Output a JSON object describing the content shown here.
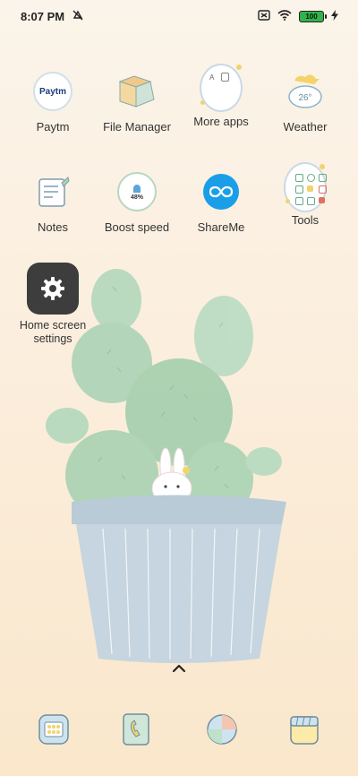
{
  "status_bar": {
    "time": "8:07 PM",
    "battery_level": "100"
  },
  "apps_row1": [
    {
      "label": "Paytm",
      "icon": "paytm-icon",
      "icon_text": "Paytm"
    },
    {
      "label": "File Manager",
      "icon": "file-manager-icon"
    },
    {
      "label": "More apps",
      "icon": "folder-more-apps-icon"
    },
    {
      "label": "Weather",
      "icon": "weather-icon",
      "icon_text": "26°"
    }
  ],
  "apps_row2": [
    {
      "label": "Notes",
      "icon": "notes-icon"
    },
    {
      "label": "Boost speed",
      "icon": "boost-speed-icon",
      "icon_text": "48%"
    },
    {
      "label": "ShareMe",
      "icon": "shareme-icon"
    },
    {
      "label": "Tools",
      "icon": "folder-tools-icon"
    }
  ],
  "home_screen_settings": {
    "label": "Home screen settings",
    "icon": "gear-icon"
  },
  "dock": [
    {
      "icon": "phone-dialer-icon"
    },
    {
      "icon": "contacts-icon"
    },
    {
      "icon": "browser-icon"
    },
    {
      "icon": "camera-icon"
    }
  ],
  "colors": {
    "shareme_blue": "#1a9ee8",
    "settings_dark": "#3d3d3d",
    "cactus_green": "#a8d4b3",
    "pot_blue": "#b8cad6"
  }
}
